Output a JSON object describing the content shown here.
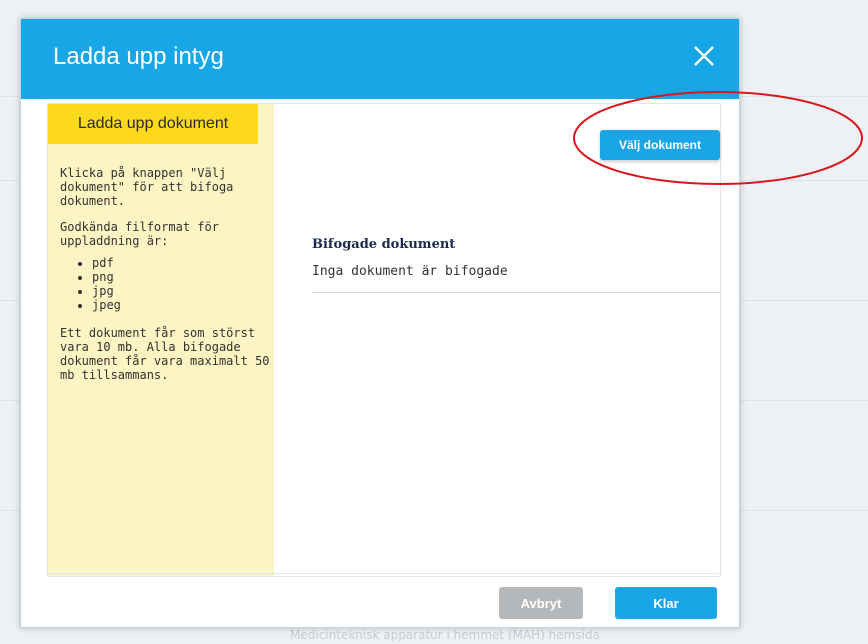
{
  "modal": {
    "title": "Ladda upp intyg",
    "close_icon": "close-icon"
  },
  "info_panel": {
    "heading": "Ladda upp dokument",
    "intro": "Klicka på knappen \"Välj dokument\" för att bifoga dokument.",
    "formats_intro": "Godkända filformat för uppladdning är:",
    "formats": [
      "pdf",
      "png",
      "jpg",
      "jpeg"
    ],
    "limits": "Ett dokument får som störst vara 10 mb. Alla bifogade dokument får vara maximalt 50 mb tillsammans."
  },
  "upload": {
    "button_label": "Välj dokument"
  },
  "attached": {
    "title": "Bifogade dokument",
    "empty_text": "Inga dokument är bifogade"
  },
  "footer": {
    "cancel_label": "Avbryt",
    "done_label": "Klar"
  },
  "colors": {
    "header": "#17a6e6",
    "primary_button": "#1aa5e6",
    "info_tab": "#fdd91d",
    "info_panel": "#fdf4c3",
    "disabled_button": "#b5b8bb",
    "annotation": "#d9171c"
  },
  "background": {
    "footer_text": "Medicinteknisk apparatur i hemmet (MAH) hemsida"
  }
}
